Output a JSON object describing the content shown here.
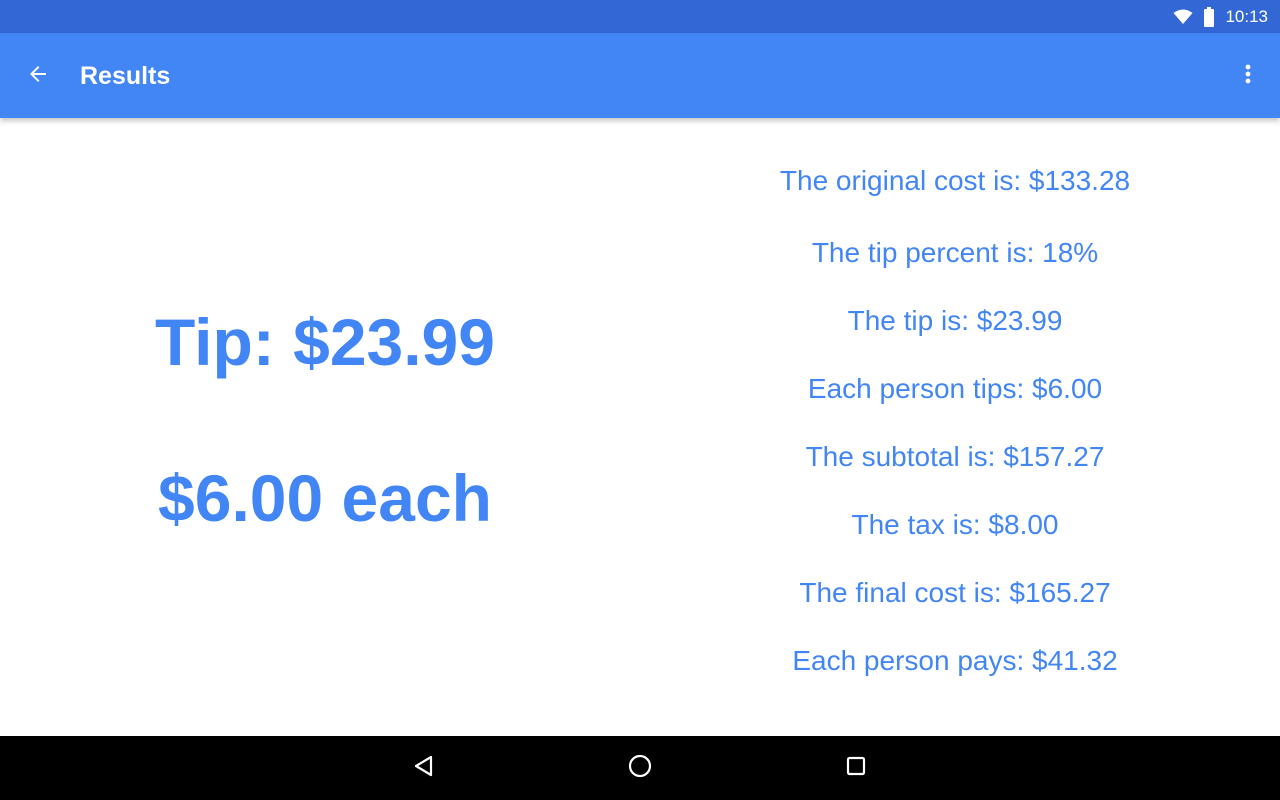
{
  "status_bar": {
    "time": "10:13",
    "icons": [
      "wifi-icon",
      "battery-icon"
    ]
  },
  "app_bar": {
    "title": "Results",
    "back_icon": "arrow-back-icon",
    "overflow_icon": "more-vert-icon"
  },
  "summary": {
    "tip": "Tip: $23.99",
    "each": "$6.00 each"
  },
  "breakdown": [
    "The original cost is: $133.28",
    "The tip percent is: 18%",
    "The tip is: $23.99",
    "Each person tips: $6.00",
    "The subtotal is: $157.27",
    "The tax is: $8.00",
    "The final cost is: $165.27",
    "Each person pays: $41.32"
  ],
  "nav_bar": {
    "icons": [
      "back-triangle-icon",
      "home-circle-icon",
      "recents-square-icon"
    ]
  },
  "colors": {
    "status_bar": "#3367d6",
    "app_bar": "#4285f4",
    "accent_text": "#4285f4",
    "nav_bar": "#000000"
  }
}
